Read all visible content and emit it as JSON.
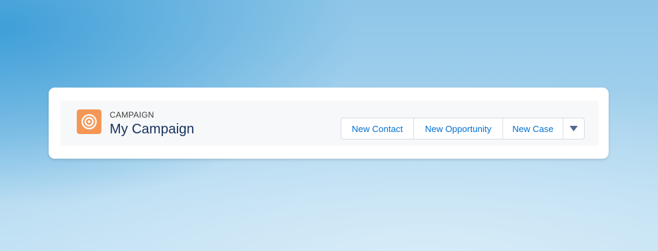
{
  "record": {
    "object_type": "CAMPAIGN",
    "name": "My Campaign",
    "icon": "campaign-target-icon",
    "icon_color": "#f49756"
  },
  "actions": {
    "new_contact": "New Contact",
    "new_opportunity": "New Opportunity",
    "new_case": "New Case",
    "more_icon": "chevron-down-icon"
  },
  "colors": {
    "link": "#0070d2",
    "title": "#16325c"
  }
}
